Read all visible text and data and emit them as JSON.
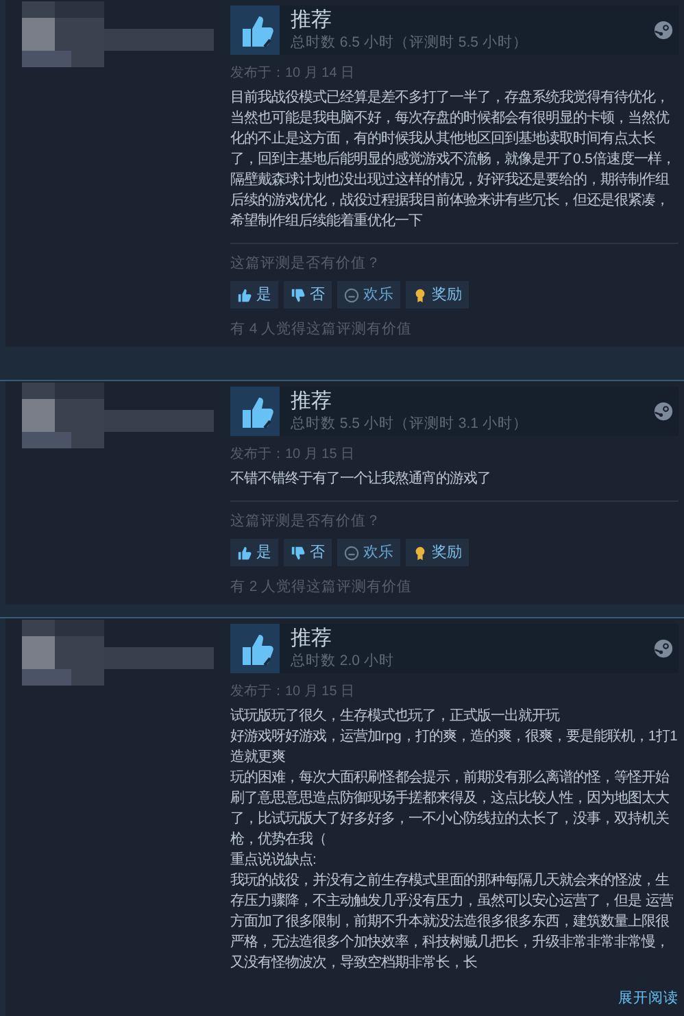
{
  "reviews": [
    {
      "verdict": "推荐",
      "hours": "总时数 6.5 小时（评测时 5.5 小时）",
      "posted": "发布于：10 月 14 日",
      "body": "目前我战役模式已经算是差不多打了一半了，存盘系统我觉得有待优化，当然也可能是我电脑不好，每次存盘的时候都会有很明显的卡顿，当然优化的不止是这方面，有的时候我从其他地区回到基地读取时间有点太长了，回到主基地后能明显的感觉游戏不流畅，就像是开了0.5倍速度一样，隔壁戴森球计划也没出现过这样的情况，好评我还是要给的，期待制作组后续的游戏优化，战役过程据我目前体验来讲有些冗长，但还是很紧凑，希望制作组后续能着重优化一下",
      "helpful_prompt": "这篇评测是否有价值？",
      "buttons": [
        {
          "kind": "yes",
          "label": "是"
        },
        {
          "kind": "no",
          "label": "否"
        },
        {
          "kind": "funny",
          "label": "欢乐"
        },
        {
          "kind": "award",
          "label": "奖励"
        }
      ],
      "helpful_count": "有 4 人觉得这篇评测有价值"
    },
    {
      "verdict": "推荐",
      "hours": "总时数 5.5 小时（评测时 3.1 小时）",
      "posted": "发布于：10 月 15 日",
      "body": "不错不错终于有了一个让我熬通宵的游戏了",
      "helpful_prompt": "这篇评测是否有价值？",
      "buttons": [
        {
          "kind": "yes",
          "label": "是"
        },
        {
          "kind": "no",
          "label": "否"
        },
        {
          "kind": "funny",
          "label": "欢乐"
        },
        {
          "kind": "award",
          "label": "奖励"
        }
      ],
      "helpful_count": "有 2 人觉得这篇评测有价值"
    },
    {
      "verdict": "推荐",
      "hours": "总时数 2.0 小时",
      "posted": "发布于：10 月 15 日",
      "body": "试玩版玩了很久，生存模式也玩了，正式版一出就开玩",
      "body_lines": [
        "好游戏呀好游戏，运营加rpg，打的爽，造的爽，很爽，要是能联机，1打1造就更爽",
        "玩的困难，每次大面积刷怪都会提示，前期没有那么离谱的怪，等怪开始刷了意思意思造点防御现场手搓都来得及，这点比较人性，因为地图太大了，比试玩版大了好多好多，一不小心防线拉的太长了，没事，双持机关枪，优势在我（",
        "重点说说缺点:",
        "我玩的战役，并没有之前生存模式里面的那种每隔几天就会来的怪波，生存压力骤降，不主动触发几乎没有压力，虽然可以安心运营了，但是 运营方面加了很多限制，前期不升本就没法造很多很多东西，建筑数量上限很严格，无法造很多个加快效率，科技树贼几把长，升级非常非常非常慢，又没有怪物波次，导致空档期非常长，长"
      ],
      "expand_link": "展开阅读"
    }
  ]
}
